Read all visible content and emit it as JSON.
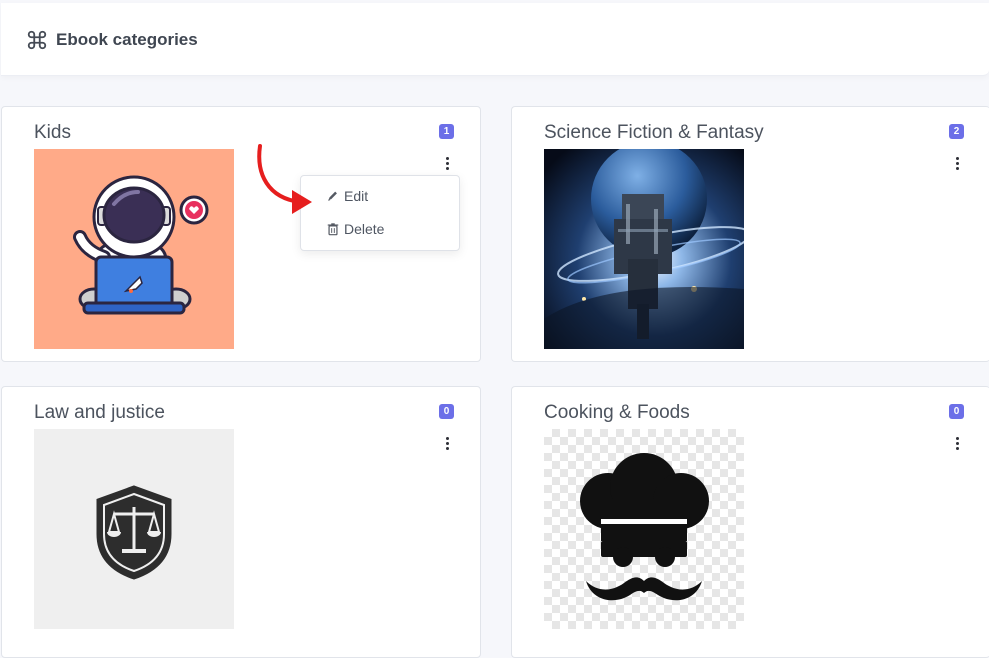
{
  "header": {
    "title": "Ebook categories",
    "icon": "command-icon"
  },
  "categories": [
    {
      "name": "Kids",
      "count": "1",
      "image": "astronaut-laptop-illustration"
    },
    {
      "name": "Science Fiction & Fantasy",
      "count": "2",
      "image": "space-station-planet"
    },
    {
      "name": "Law and justice",
      "count": "0",
      "image": "scales-shield-icon"
    },
    {
      "name": "Cooking & Foods",
      "count": "0",
      "image": "chef-hat-mustache-icon"
    }
  ],
  "dropdown": {
    "edit_label": "Edit",
    "delete_label": "Delete"
  },
  "colors": {
    "badge": "#6c6fe8",
    "annotation_arrow": "#e61e1e",
    "kids_bg": "#ffaa88"
  }
}
